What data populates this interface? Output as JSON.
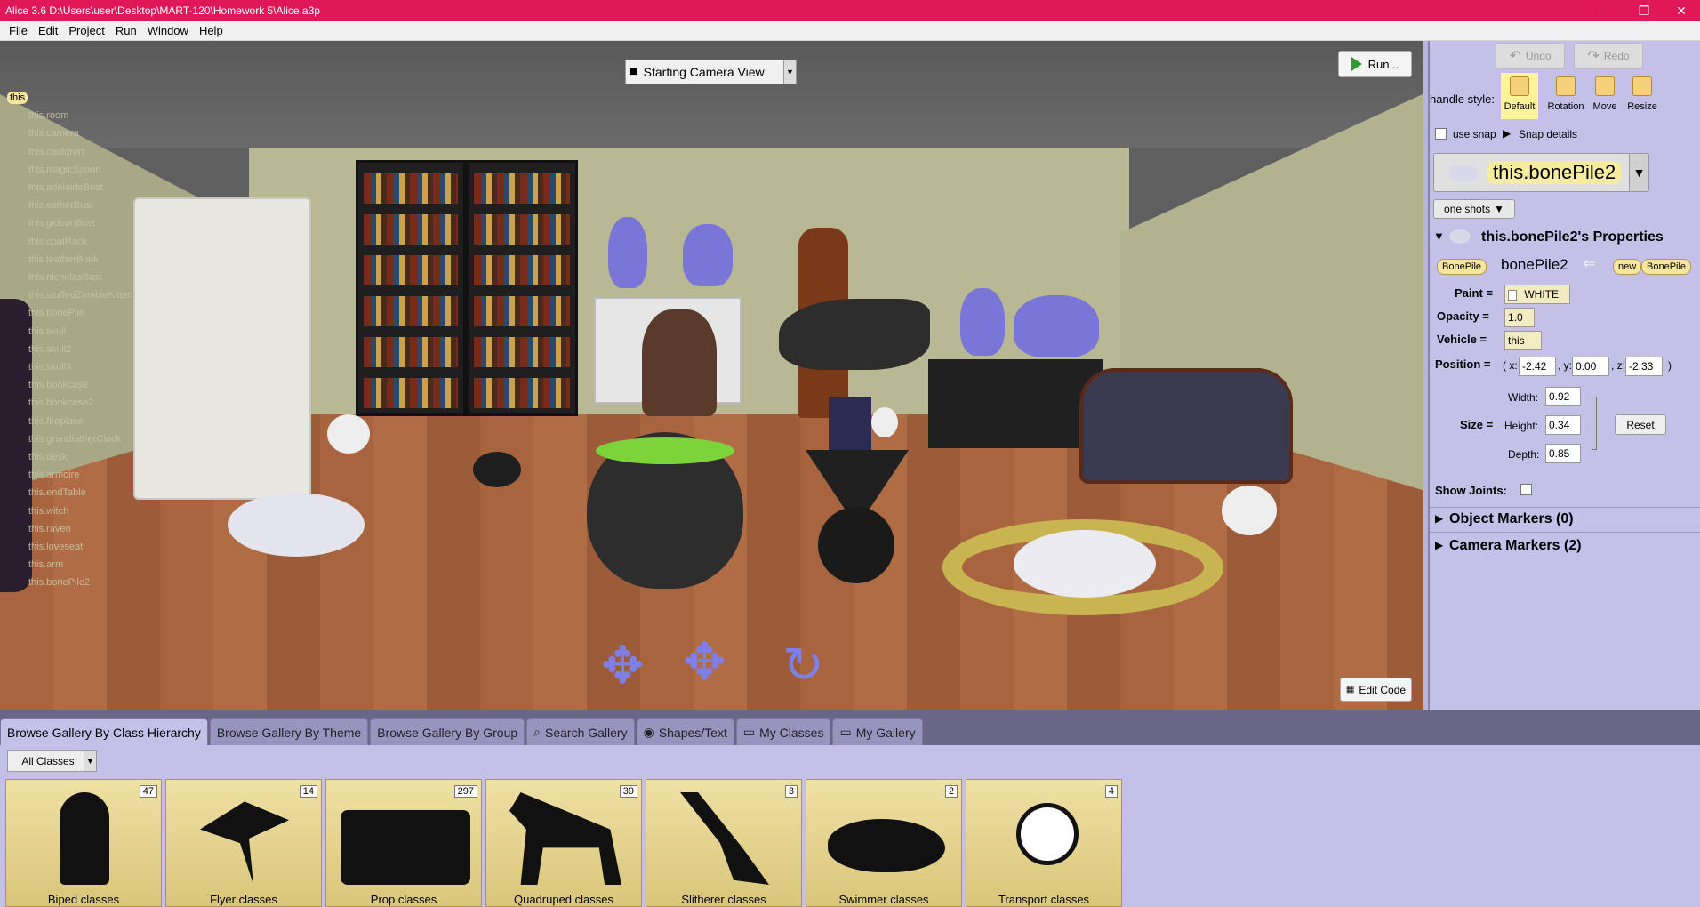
{
  "window": {
    "title": "Alice 3.6 D:\\Users\\user\\Desktop\\MART-120\\Homework 5\\Alice.a3p",
    "min": "—",
    "max": "❐",
    "close": "✕"
  },
  "menu": [
    "File",
    "Edit",
    "Project",
    "Run",
    "Window",
    "Help"
  ],
  "scene": {
    "camera_view": "Starting Camera View",
    "run_label": "Run...",
    "edit_code_label": "Edit Code",
    "tree_root": "this",
    "tree_items": [
      "this.room",
      "this.camera",
      "this.cauldron",
      "this.magicSpoon",
      "this.adelaideBust",
      "this.estherBust",
      "this.gideonBust",
      "this.coatRack",
      "this.leatherBook",
      "this.nicholasBust",
      "this.stuffedZombieKitten",
      "this.bonePile",
      "this.skull",
      "this.skull2",
      "this.skull3",
      "this.bookcase",
      "this.bookcase2",
      "this.fireplace",
      "this.grandfatherClock",
      "this.desk",
      "this.armoire",
      "this.endTable",
      "this.witch",
      "this.raven",
      "this.loveseat",
      "this.arm",
      "this.bonePile2"
    ]
  },
  "panel": {
    "undo": "Undo",
    "redo": "Redo",
    "handle_style_label": "handle style:",
    "handle_styles": [
      "Default",
      "Rotation",
      "Move",
      "Resize"
    ],
    "use_snap": "use snap",
    "snap_details": "Snap details",
    "selected_object": "this.bonePile2",
    "one_shots": "one shots",
    "properties_title": "this.bonePile2's Properties",
    "type_pill": "BonePile",
    "instance_name": "bonePile2",
    "new_pill": "new",
    "new_type_pill": "BonePile",
    "paint_label": "Paint =",
    "paint_value": "WHITE",
    "opacity_label": "Opacity =",
    "opacity_value": "1.0",
    "vehicle_label": "Vehicle =",
    "vehicle_value": "this",
    "position_label": "Position =",
    "pos_x_label": "( x:",
    "pos_x": "-2.42",
    "pos_y_label": ", y:",
    "pos_y": "0.00",
    "pos_z_label": ", z:",
    "pos_z": "-2.33",
    "pos_close": ")",
    "size_label": "Size =",
    "width_label": "Width:",
    "width": "0.92",
    "height_label": "Height:",
    "height": "0.34",
    "depth_label": "Depth:",
    "depth": "0.85",
    "reset": "Reset",
    "show_joints": "Show Joints:",
    "object_markers": "Object Markers (0)",
    "camera_markers": "Camera Markers (2)"
  },
  "gallery": {
    "tabs": [
      "Browse Gallery By Class Hierarchy",
      "Browse Gallery By Theme",
      "Browse Gallery By Group",
      "Search Gallery",
      "Shapes/Text",
      "My Classes",
      "My Gallery"
    ],
    "filter": "All Classes",
    "cards": [
      {
        "label": "Biped classes",
        "count": "47"
      },
      {
        "label": "Flyer classes",
        "count": "14"
      },
      {
        "label": "Prop classes",
        "count": "297"
      },
      {
        "label": "Quadruped classes",
        "count": "39"
      },
      {
        "label": "Slitherer classes",
        "count": "3"
      },
      {
        "label": "Swimmer classes",
        "count": "2"
      },
      {
        "label": "Transport classes",
        "count": "4"
      }
    ]
  }
}
